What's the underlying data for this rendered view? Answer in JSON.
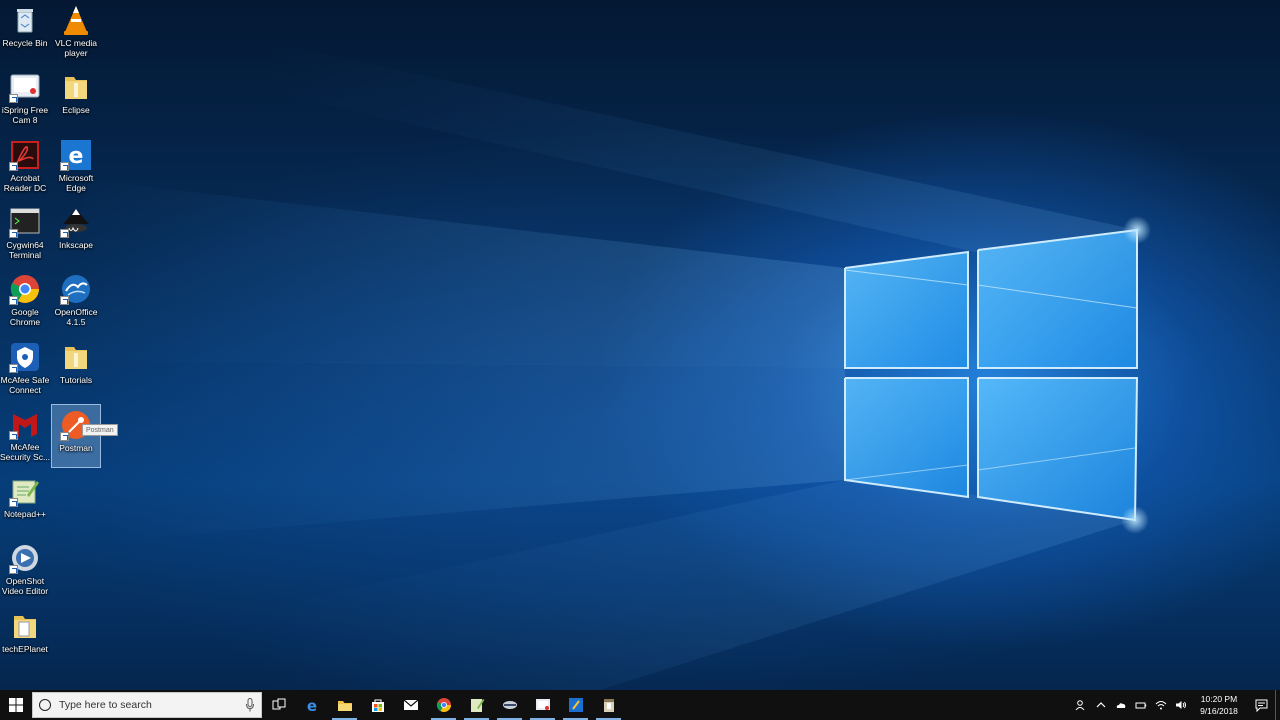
{
  "desktop": {
    "icons": [
      {
        "id": "recycle-bin",
        "label": "Recycle Bin"
      },
      {
        "id": "vlc",
        "label": "VLC media\nplayer"
      },
      {
        "id": "ispring",
        "label": "iSpring Free\nCam 8"
      },
      {
        "id": "eclipse",
        "label": "Eclipse"
      },
      {
        "id": "acrobat",
        "label": "Acrobat\nReader DC"
      },
      {
        "id": "edge",
        "label": "Microsoft\nEdge"
      },
      {
        "id": "cygwin",
        "label": "Cygwin64\nTerminal"
      },
      {
        "id": "inkscape",
        "label": "Inkscape"
      },
      {
        "id": "chrome",
        "label": "Google\nChrome"
      },
      {
        "id": "openoffice",
        "label": "OpenOffice\n4.1.5"
      },
      {
        "id": "mcafee-safe",
        "label": "McAfee Safe\nConnect"
      },
      {
        "id": "tutorials",
        "label": "Tutorials"
      },
      {
        "id": "mcafee-security",
        "label": "McAfee\nSecurity Sc..."
      },
      {
        "id": "postman",
        "label": "Postman"
      },
      {
        "id": "notepadpp",
        "label": "Notepad++"
      },
      {
        "id": "openshot",
        "label": "OpenShot\nVideo Editor"
      },
      {
        "id": "techeplanet",
        "label": "techEPlanet"
      }
    ],
    "selected_icon": "postman",
    "tooltip": "Postman"
  },
  "taskbar": {
    "search_placeholder": "Type here to search",
    "pinned": [
      "task-view",
      "edge",
      "file-explorer",
      "store",
      "mail",
      "chrome",
      "notepadpp",
      "postman-app",
      "ispring-app",
      "acrobat-app",
      "archive-app"
    ],
    "clock": {
      "time": "10:20 PM",
      "date": "9/16/2018"
    }
  },
  "colors": {
    "taskbar": "#101010",
    "accent": "#1a6fd0",
    "selection": "#a0c8f0"
  }
}
